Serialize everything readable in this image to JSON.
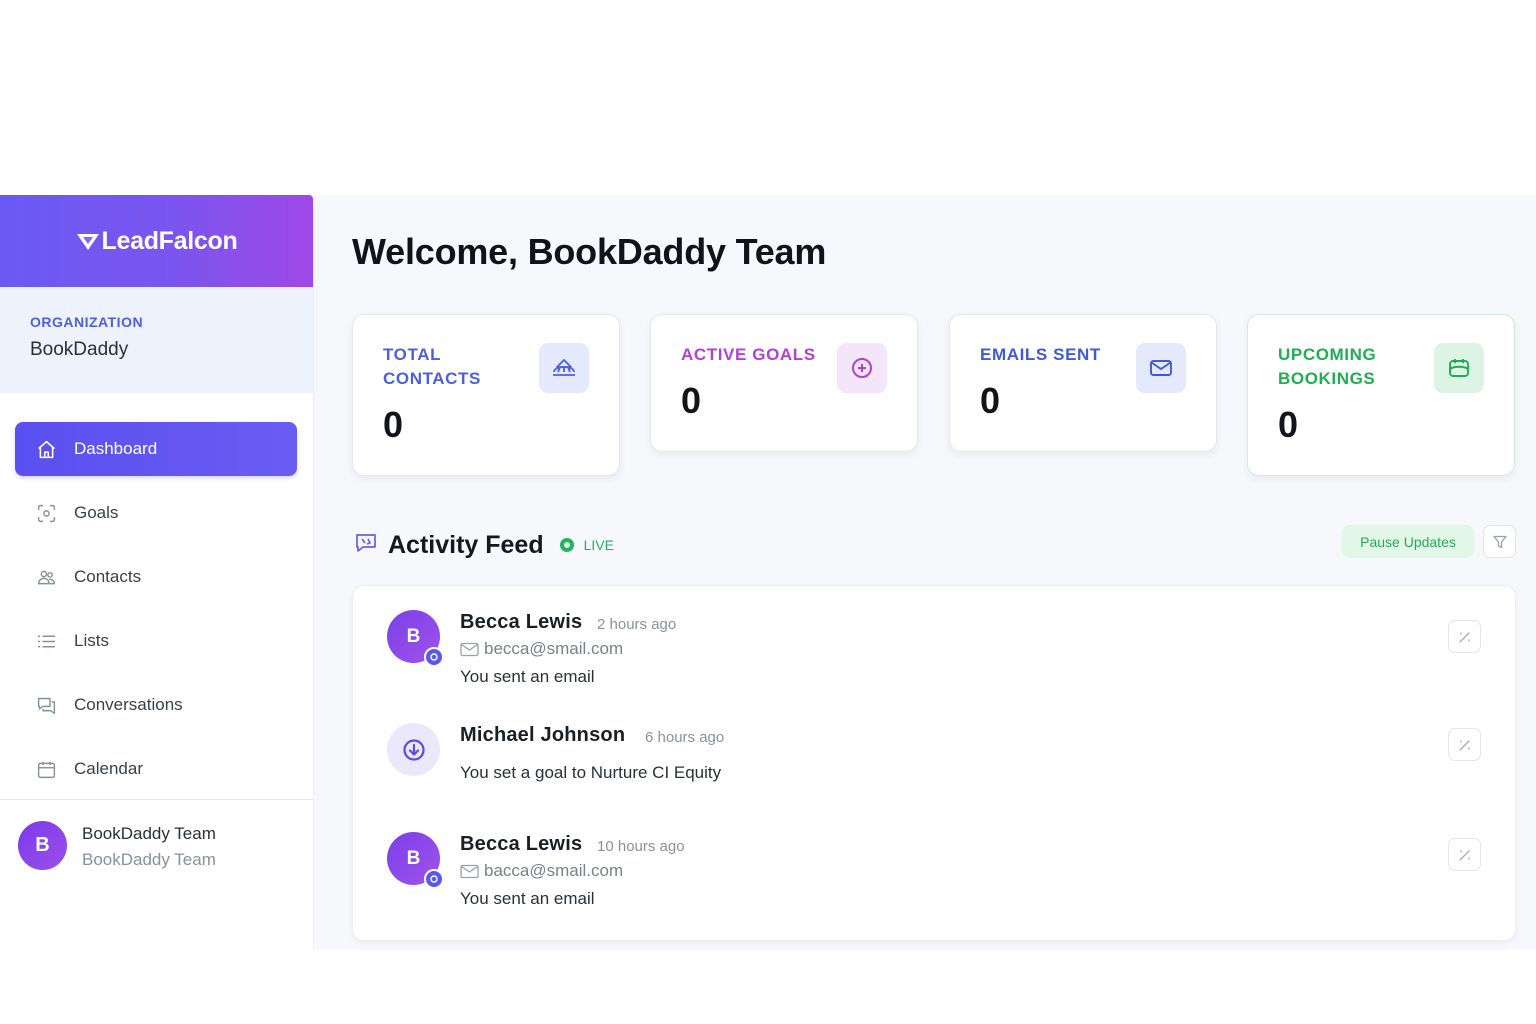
{
  "brand": {
    "name": "LeadFalcon",
    "logo_icon": "falcon-chevron-icon"
  },
  "organization": {
    "label": "ORGANIZATION",
    "name": "BookDaddy"
  },
  "nav": {
    "items": [
      {
        "label": "Dashboard",
        "icon": "home-icon",
        "active": true
      },
      {
        "label": "Goals",
        "icon": "target-icon"
      },
      {
        "label": "Contacts",
        "icon": "contacts-icon"
      },
      {
        "label": "Lists",
        "icon": "list-icon"
      },
      {
        "label": "Conversations",
        "icon": "chat-icon"
      },
      {
        "label": "Calendar",
        "icon": "calendar-icon"
      }
    ]
  },
  "user": {
    "initial": "B",
    "name": "BookDaddy Team",
    "subtitle": "BookDaddy Team"
  },
  "header": {
    "welcome": "Welcome, BookDaddy Team"
  },
  "stats": [
    {
      "label": "TOTAL CONTACTS",
      "value": "0",
      "color": "#4d5fe0",
      "icon": "contacts-icon",
      "icon_bg": "#e4e9fb"
    },
    {
      "label": "ACTIVE GOALS",
      "value": "0",
      "color": "#b23fd8",
      "icon": "plus-circle-icon",
      "icon_bg": "#f3e6fb"
    },
    {
      "label": "EMAILS SENT",
      "value": "0",
      "color": "#4159d6",
      "icon": "mail-icon",
      "icon_bg": "#e4e9fb"
    },
    {
      "label": "UPCOMING BOOKINGS",
      "value": "0",
      "color": "#1fae52",
      "icon": "calendar-icon",
      "icon_bg": "#dcf4e5"
    }
  ],
  "feed": {
    "title": "Activity Feed",
    "live_label": "LIVE",
    "pause_label": "Pause Updates",
    "items": [
      {
        "type": "email",
        "initial": "B",
        "name": "Becca Lewis",
        "time": "2 hours ago",
        "email": "becca@smail.com",
        "text": "You sent an email"
      },
      {
        "type": "goal",
        "name": "Michael Johnson",
        "time": "6 hours ago",
        "text": "You set a goal to Nurture CI Equity"
      },
      {
        "type": "email",
        "initial": "B",
        "name": "Becca Lewis",
        "time": "10 hours ago",
        "email": "bacca@smail.com",
        "text": "You sent an email"
      }
    ]
  },
  "colors": {
    "accent": "#5a4ff0",
    "live": "#22b35e"
  }
}
